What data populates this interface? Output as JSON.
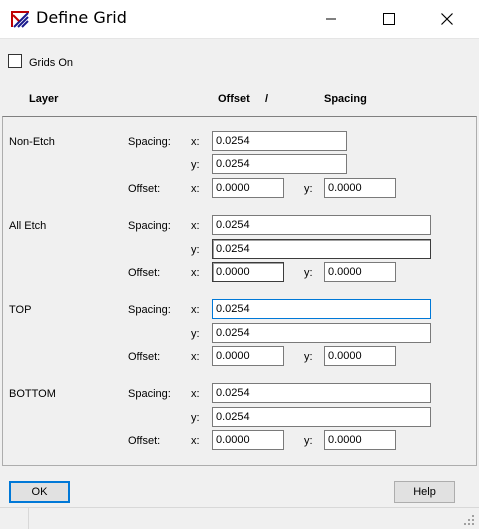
{
  "window": {
    "title": "Define Grid",
    "icon": "pcb-grid-app-icon",
    "controls": [
      "minimize-icon",
      "maximize-icon",
      "close-icon"
    ]
  },
  "grids_on": {
    "label": "Grids On",
    "checked": false
  },
  "headers": {
    "layer": "Layer",
    "offset": "Offset",
    "slash": "/",
    "spacing": "Spacing"
  },
  "row_labels": {
    "spacing": "Spacing:",
    "x": "x:",
    "y": "y:",
    "offset": "Offset:",
    "offset_x": "x:",
    "offset_y": "y:"
  },
  "layers": [
    {
      "name": "Non-Etch",
      "spacing_x": "0.0254",
      "spacing_y": "0.0254",
      "offset_x": "0.0000",
      "offset_y": "0.0000"
    },
    {
      "name": "All Etch",
      "spacing_x": "0.0254",
      "spacing_y": "0.0254",
      "offset_x": "0.0000",
      "offset_y": "0.0000"
    },
    {
      "name": "TOP",
      "spacing_x": "0.0254",
      "spacing_y": "0.0254",
      "offset_x": "0.0000",
      "offset_y": "0.0000"
    },
    {
      "name": "BOTTOM",
      "spacing_x": "0.0254",
      "spacing_y": "0.0254",
      "offset_x": "0.0000",
      "offset_y": "0.0000"
    }
  ],
  "buttons": {
    "ok": "OK",
    "help": "Help"
  }
}
